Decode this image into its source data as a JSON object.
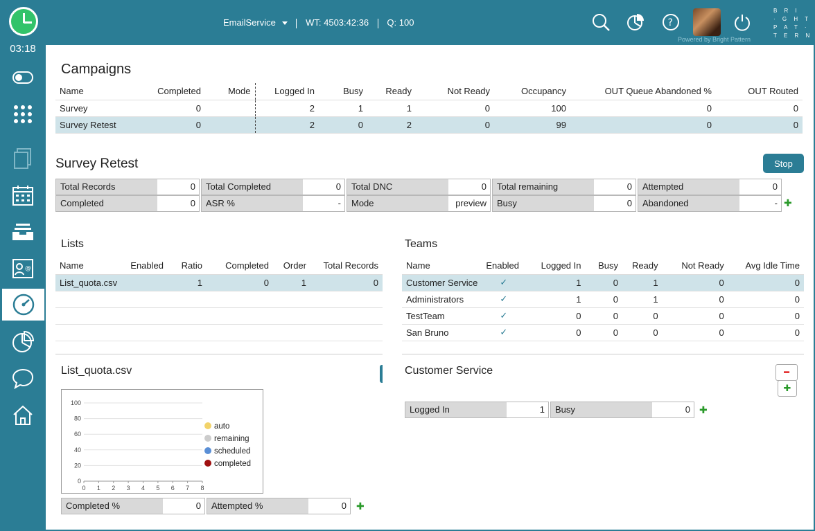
{
  "sidebar": {
    "timer": "03:18",
    "items": [
      "toggle-icon",
      "dialpad-icon",
      "documents-icon",
      "calendar-icon",
      "inbox-icon",
      "contact-card-icon",
      "gauge-icon",
      "pie-chart-icon",
      "chat-icon",
      "home-icon"
    ],
    "active": "gauge-icon"
  },
  "header": {
    "service": "EmailService",
    "wt": "WT: 4503:42:36",
    "q": "Q: 100",
    "powered": "Powered by Bright Pattern",
    "logo_lines": [
      "B R I",
      "· G H T",
      "P A T ·",
      "T E R N"
    ]
  },
  "campaigns": {
    "title": "Campaigns",
    "columns": [
      "Name",
      "Completed",
      "Mode",
      "Logged In",
      "Busy",
      "Ready",
      "Not Ready",
      "Occupancy",
      "OUT Queue Abandoned %",
      "OUT Routed"
    ],
    "rows": [
      [
        "Survey",
        "0",
        "",
        "2",
        "1",
        "1",
        "0",
        "100",
        "0",
        "0"
      ],
      [
        "Survey Retest",
        "0",
        "",
        "2",
        "0",
        "2",
        "0",
        "99",
        "0",
        "0"
      ]
    ]
  },
  "details": {
    "title": "Survey Retest",
    "stop_label": "Stop",
    "row1": [
      [
        "Total Records",
        "0"
      ],
      [
        "Total Completed",
        "0"
      ],
      [
        "Total DNC",
        "0"
      ],
      [
        "Total remaining",
        "0"
      ],
      [
        "Attempted",
        "0"
      ]
    ],
    "row2": [
      [
        "Completed",
        "0"
      ],
      [
        "ASR %",
        "-"
      ],
      [
        "Mode",
        "preview"
      ],
      [
        "Busy",
        "0"
      ],
      [
        "Abandoned",
        "-"
      ]
    ]
  },
  "lists": {
    "title": "Lists",
    "columns": [
      "Name",
      "Enabled",
      "Ratio",
      "Completed",
      "Order",
      "Total Records"
    ],
    "rows": [
      [
        "List_quota.csv",
        "",
        "1",
        "0",
        "1",
        "0"
      ]
    ]
  },
  "teams": {
    "title": "Teams",
    "columns": [
      "Name",
      "Enabled",
      "Logged In",
      "Busy",
      "Ready",
      "Not Ready",
      "Avg Idle Time"
    ],
    "rows": [
      [
        "Customer Service",
        "✓",
        "1",
        "0",
        "1",
        "0",
        "0"
      ],
      [
        "Administrators",
        "✓",
        "1",
        "0",
        "1",
        "0",
        "0"
      ],
      [
        "TestTeam",
        "✓",
        "0",
        "0",
        "0",
        "0",
        "0"
      ],
      [
        "San Bruno",
        "✓",
        "0",
        "0",
        "0",
        "0",
        "0"
      ]
    ]
  },
  "list_panel": {
    "title": "List_quota.csv",
    "stats": [
      [
        "Completed %",
        "0"
      ],
      [
        "Attempted %",
        "0"
      ]
    ]
  },
  "team_panel": {
    "title": "Customer Service",
    "stats": [
      [
        "Logged In",
        "1"
      ],
      [
        "Busy",
        "0"
      ]
    ]
  },
  "chart_data": {
    "type": "pie",
    "title": "",
    "yticks": [
      "100",
      "80",
      "60",
      "40",
      "20",
      "0"
    ],
    "xticks": [
      "0",
      "1",
      "2",
      "3",
      "4",
      "5",
      "6",
      "7",
      "8"
    ],
    "ylim": [
      0,
      100
    ],
    "xlim": [
      0,
      8
    ],
    "series": [
      {
        "name": "auto",
        "color": "#f2d36a",
        "value": 0
      },
      {
        "name": "remaining",
        "color": "#cccccc",
        "value": 0
      },
      {
        "name": "scheduled",
        "color": "#5a8fd6",
        "value": 0
      },
      {
        "name": "completed",
        "color": "#a01010",
        "value": 0
      }
    ],
    "legend": "right"
  }
}
